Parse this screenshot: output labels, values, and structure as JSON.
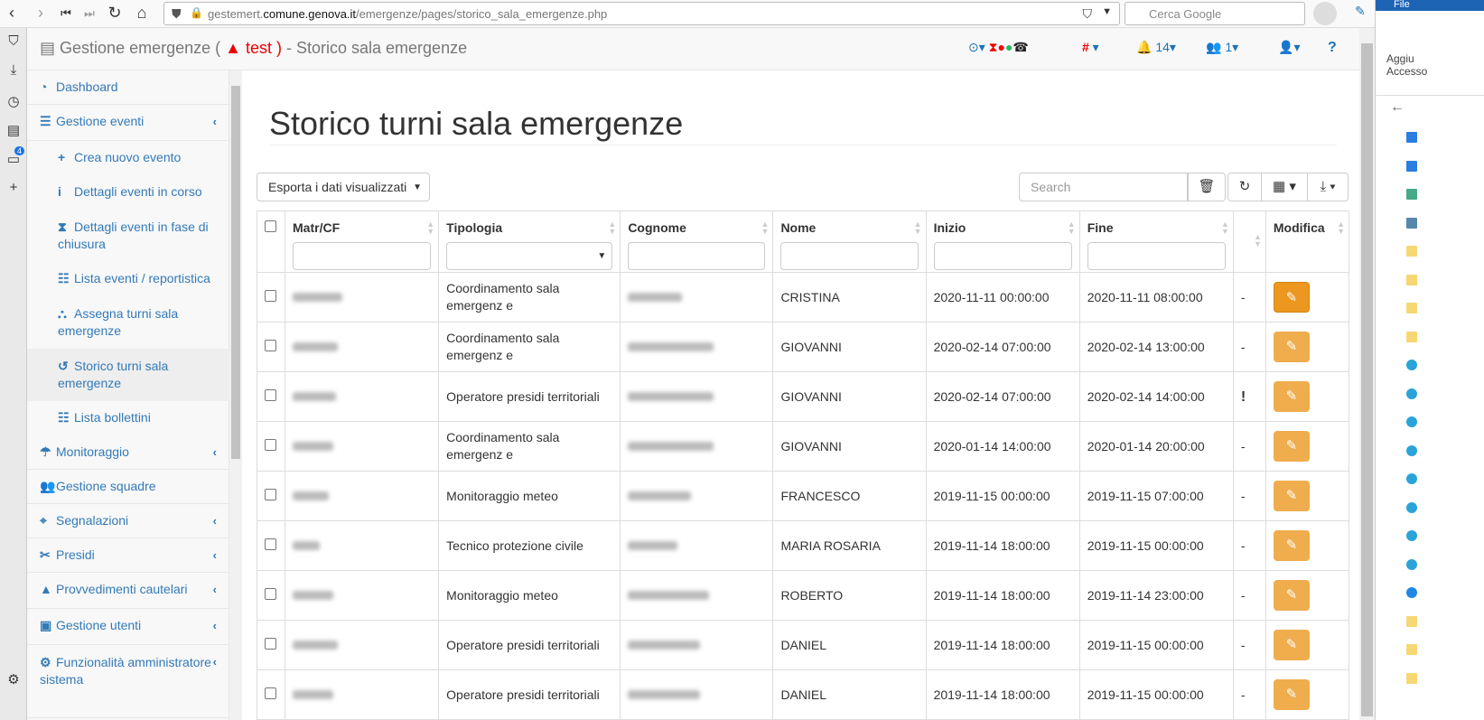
{
  "browser": {
    "url_prefix": "gestemert.",
    "url_domain": "comune.genova.it",
    "url_path": "/emergenze/pages/storico_sala_emergenze.php",
    "search_placeholder": "Cerca Google",
    "badge": "4"
  },
  "right_panel": {
    "tab": "File",
    "label1": "Aggiu",
    "label2": "Accesso"
  },
  "header": {
    "title_pre": "Gestione emergenze (",
    "env": "test )",
    "title_post": " - Storico sala emergenze",
    "notifications": "14",
    "users": "1",
    "help": "?",
    "hash": "#"
  },
  "sidebar": {
    "items": [
      {
        "label": "Dashboard",
        "icon": "dashboard-icon",
        "glyph": "◔"
      },
      {
        "label": "Gestione eventi",
        "icon": "bars-icon",
        "glyph": "☰",
        "chevron": true
      },
      {
        "label": "Crea nuovo evento",
        "icon": "plus-icon",
        "glyph": "+",
        "sub": true
      },
      {
        "label": "Dettagli eventi in corso",
        "icon": "info-icon",
        "glyph": "i",
        "sub": true
      },
      {
        "label": "Dettagli eventi in fase di chiusura",
        "icon": "hourglass-icon",
        "glyph": "⧗",
        "sub": true
      },
      {
        "label": "Lista eventi / reportistica",
        "icon": "list-icon",
        "glyph": "☷",
        "sub": true
      },
      {
        "label": "Assegna turni sala emergenze",
        "icon": "sitemap-icon",
        "glyph": "⛬",
        "sub": true
      },
      {
        "label": "Storico turni sala emergenze",
        "icon": "history-icon",
        "glyph": "↺",
        "sub": true,
        "active": true
      },
      {
        "label": "Lista bollettini",
        "icon": "list-icon",
        "glyph": "☷",
        "sub": true
      },
      {
        "label": "Monitoraggio",
        "icon": "cloud-rain-icon",
        "glyph": "☂",
        "chevron": true
      },
      {
        "label": "Gestione squadre",
        "icon": "users-icon",
        "glyph": "👥"
      },
      {
        "label": "Segnalazioni",
        "icon": "map-icon",
        "glyph": "⌖",
        "chevron": true
      },
      {
        "label": "Presidi",
        "icon": "tools-icon",
        "glyph": "✂",
        "chevron": true
      },
      {
        "label": "Provvedimenti cautelari",
        "icon": "warning-icon",
        "glyph": "▲",
        "chevron": true
      },
      {
        "label": "Gestione utenti",
        "icon": "id-card-icon",
        "glyph": "▣",
        "chevron": true
      },
      {
        "label": "Funzionalità amministratore sistema",
        "icon": "user-cog-icon",
        "glyph": "⚙",
        "chevron": true
      }
    ]
  },
  "main": {
    "title": "Storico turni sala emergenze",
    "export_label": "Esporta i dati visualizzati",
    "search_placeholder": "Search",
    "columns": [
      "Matr/CF",
      "Tipologia",
      "Cognome",
      "Nome",
      "Inizio",
      "Fine",
      "",
      "Modifica"
    ],
    "rows": [
      {
        "tipologia": "Coordinamento sala emergenz e",
        "nome": "CRISTINA",
        "inizio": "2020-11-11 00:00:00",
        "fine": "2020-11-11 08:00:00",
        "flag": "-"
      },
      {
        "tipologia": "Coordinamento sala emergenz e",
        "nome": "GIOVANNI",
        "inizio": "2020-02-14 07:00:00",
        "fine": "2020-02-14 13:00:00",
        "flag": "-"
      },
      {
        "tipologia": "Operatore presidi territoriali",
        "nome": "GIOVANNI",
        "inizio": "2020-02-14 07:00:00",
        "fine": "2020-02-14 14:00:00",
        "flag": "!"
      },
      {
        "tipologia": "Coordinamento sala emergenz e",
        "nome": "GIOVANNI",
        "inizio": "2020-01-14 14:00:00",
        "fine": "2020-01-14 20:00:00",
        "flag": "-"
      },
      {
        "tipologia": "Monitoraggio meteo",
        "nome": "FRANCESCO",
        "inizio": "2019-11-15 00:00:00",
        "fine": "2019-11-15 07:00:00",
        "flag": "-"
      },
      {
        "tipologia": "Tecnico protezione civile",
        "nome": "MARIA ROSARIA",
        "inizio": "2019-11-14 18:00:00",
        "fine": "2019-11-15 00:00:00",
        "flag": "-"
      },
      {
        "tipologia": "Monitoraggio meteo",
        "nome": "ROBERTO",
        "inizio": "2019-11-14 18:00:00",
        "fine": "2019-11-14 23:00:00",
        "flag": "-"
      },
      {
        "tipologia": "Operatore presidi territoriali",
        "nome": "DANIEL",
        "inizio": "2019-11-14 18:00:00",
        "fine": "2019-11-15 00:00:00",
        "flag": "-"
      },
      {
        "tipologia": "Operatore presidi territoriali",
        "nome": "DANIEL",
        "inizio": "2019-11-14 18:00:00",
        "fine": "2019-11-15 00:00:00",
        "flag": "-"
      }
    ]
  }
}
